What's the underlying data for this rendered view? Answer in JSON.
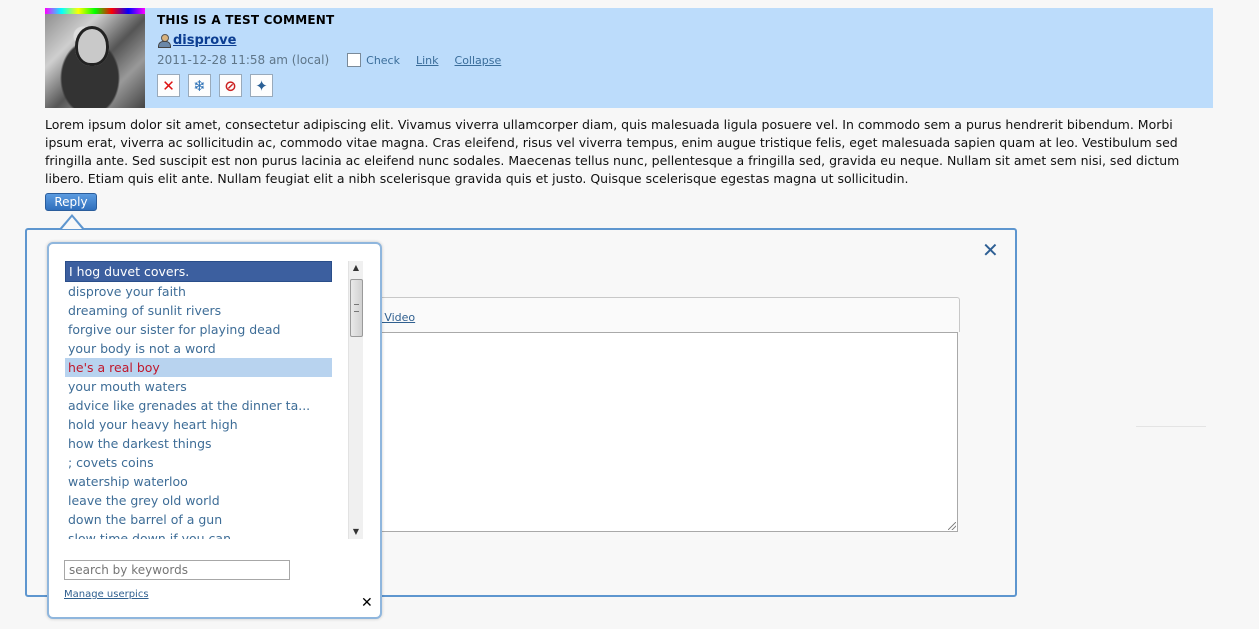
{
  "comment": {
    "title": "THIS IS A TEST COMMENT",
    "username": "disprove",
    "date": "2011-12-28 11:58 am (local)",
    "check_label": "Check",
    "link_label": "Link",
    "collapse_label": "Collapse",
    "body": "Lorem ipsum dolor sit amet, consectetur adipiscing elit. Vivamus viverra ullamcorper diam, quis malesuada ligula posuere vel. In commodo sem a purus hendrerit bibendum. Morbi ipsum erat, viverra ac sollicitudin ac, commodo vitae magna. Cras eleifend, risus vel viverra tempus, enim augue tristique felis, eget malesuada sapien quam at leo. Vestibulum sed fringilla ante. Sed suscipit est non purus lacinia ac eleifend nunc sodales. Maecenas tellus nunc, pellentesque a fringilla sed, gravida eu neque. Nullam sit amet sem nisi, sed dictum libero. Etiam quis elit ante. Nullam feugiat elit a nibh scelerisque gravida quis et justo. Quisque scelerisque egestas magna ut sollicitudin."
  },
  "reply": {
    "button_label": "Reply",
    "close_glyph": "✕",
    "insert_video_fragment": "rt Video"
  },
  "userpics": {
    "items": [
      "I hog duvet covers.",
      "disprove your faith",
      "dreaming of sunlit rivers",
      "forgive our sister for playing dead",
      "your body is not a word",
      "he's a real boy",
      "your mouth waters",
      "advice like grenades at the dinner ta...",
      "hold your heavy heart high",
      "how the darkest things",
      "; covets coins",
      "watership waterloo",
      "leave the grey old world",
      "down the barrel of a gun",
      "slow time down if you can"
    ],
    "selected_index": 0,
    "hover_index": 5,
    "search_placeholder": "search by keywords",
    "manage_label": "Manage userpics",
    "close_glyph": "✕"
  },
  "colors": {
    "header_bg": "#bcdcfb",
    "selected_bg": "#3c5f9f",
    "hover_text": "#c0182c",
    "link": "#3e6d97"
  }
}
